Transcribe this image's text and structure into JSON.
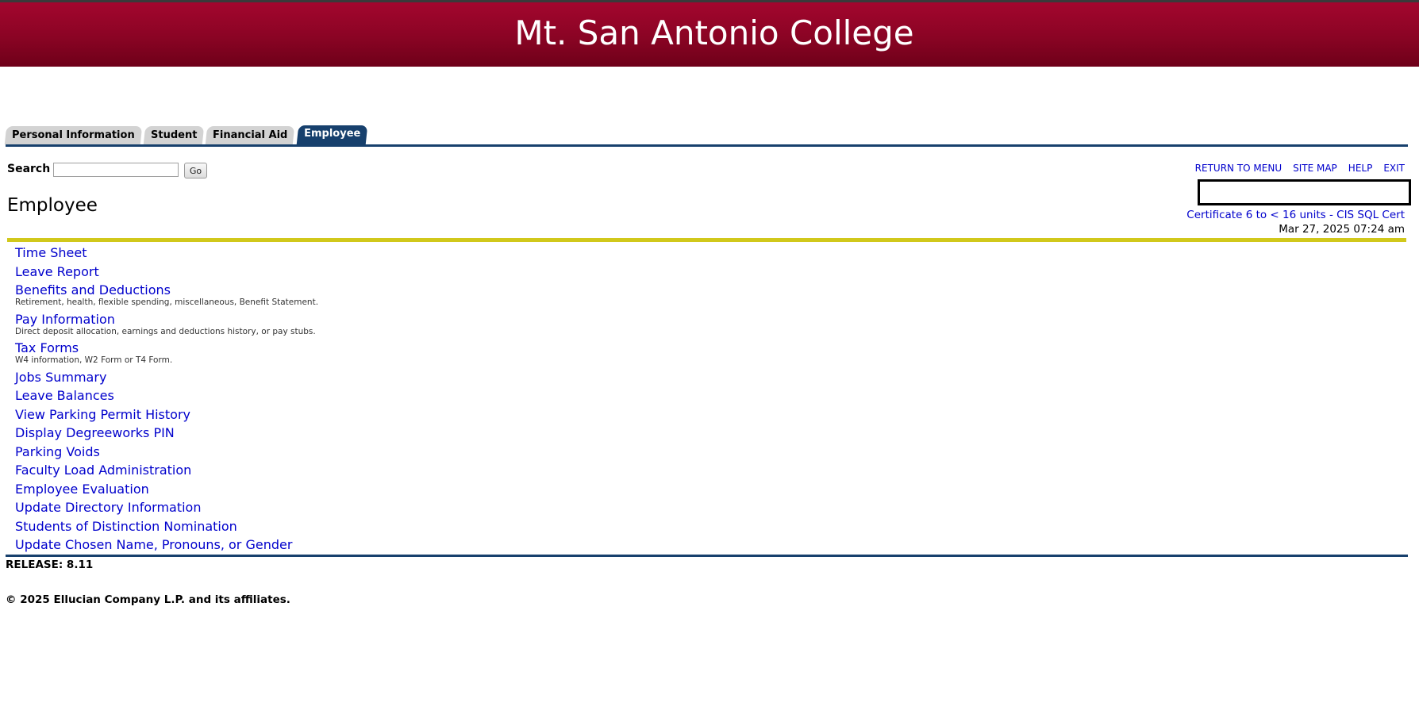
{
  "header": {
    "college_name": "Mt. San Antonio College",
    "brand_color": "#8a0424"
  },
  "tabs": [
    {
      "label": "Personal Information",
      "active": false
    },
    {
      "label": "Student",
      "active": false
    },
    {
      "label": "Financial Aid",
      "active": false
    },
    {
      "label": "Employee",
      "active": true
    }
  ],
  "search": {
    "label": "Search",
    "value": "",
    "placeholder": "",
    "go_label": "Go"
  },
  "toplinks": {
    "return_to_menu": "RETURN TO MENU",
    "site_map": "SITE MAP",
    "help": "HELP",
    "exit": "EXIT"
  },
  "page": {
    "title": "Employee",
    "certificate_link": "Certificate 6 to < 16 units - CIS SQL Cert",
    "datetime": "Mar 27, 2025 07:24 am"
  },
  "menu": [
    {
      "label": "Time Sheet",
      "desc": ""
    },
    {
      "label": "Leave Report",
      "desc": ""
    },
    {
      "label": "Benefits and Deductions",
      "desc": "Retirement, health, flexible spending, miscellaneous, Benefit Statement."
    },
    {
      "label": "Pay Information",
      "desc": "Direct deposit allocation, earnings and deductions history, or pay stubs."
    },
    {
      "label": "Tax Forms",
      "desc": "W4 information, W2 Form or T4 Form."
    },
    {
      "label": "Jobs Summary",
      "desc": ""
    },
    {
      "label": "Leave Balances",
      "desc": ""
    },
    {
      "label": "View Parking Permit History",
      "desc": ""
    },
    {
      "label": "Display Degreeworks PIN",
      "desc": ""
    },
    {
      "label": "Parking Voids",
      "desc": ""
    },
    {
      "label": "Faculty Load Administration",
      "desc": ""
    },
    {
      "label": "Employee Evaluation",
      "desc": ""
    },
    {
      "label": "Update Directory Information",
      "desc": ""
    },
    {
      "label": "Students of Distinction Nomination",
      "desc": ""
    },
    {
      "label": "Update Chosen Name, Pronouns, or Gender",
      "desc": ""
    }
  ],
  "footer": {
    "release": "RELEASE: 8.11",
    "copyright": "© 2025 Ellucian Company L.P. and its affiliates."
  }
}
